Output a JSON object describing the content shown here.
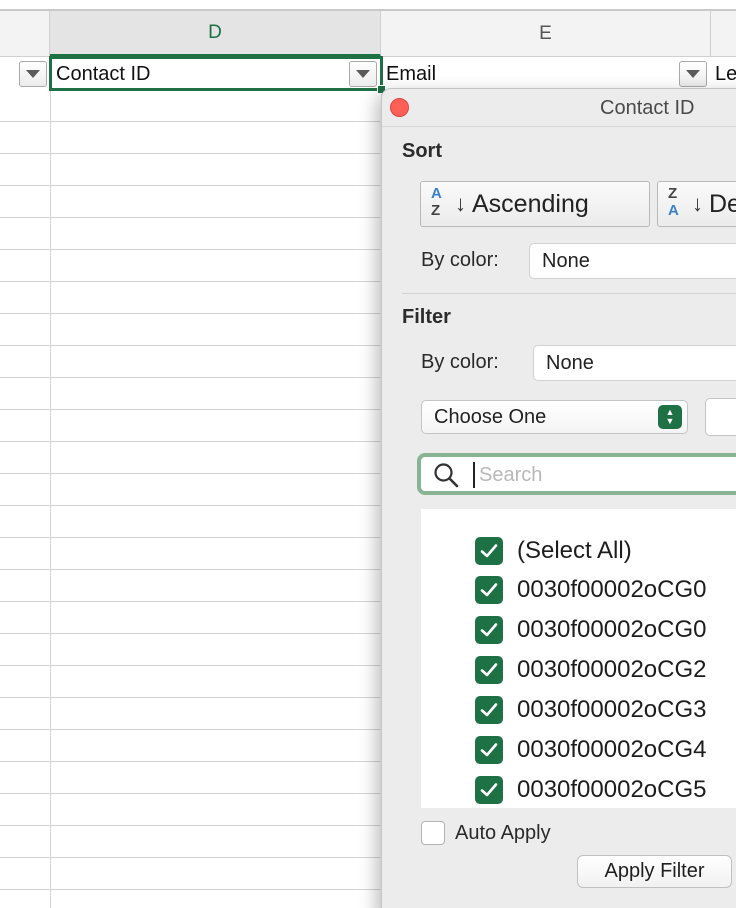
{
  "sheet": {
    "columns": [
      {
        "letter": "D"
      },
      {
        "letter": "E"
      }
    ],
    "headers": {
      "contact_id": "Contact ID",
      "email": "Email",
      "next": "Le"
    }
  },
  "filter_panel": {
    "title": "Contact ID",
    "sort": {
      "label": "Sort",
      "ascending_label": "Ascending",
      "descending_label": "De",
      "by_color_label": "By color:",
      "by_color_value": "None"
    },
    "filter": {
      "label": "Filter",
      "by_color_label": "By color:",
      "by_color_value": "None",
      "condition_value": "Choose One"
    },
    "search": {
      "placeholder": "Search",
      "value": ""
    },
    "items": [
      {
        "label": "(Select All)",
        "checked": true
      },
      {
        "label": "0030f00002oCG0",
        "checked": true
      },
      {
        "label": "0030f00002oCG0",
        "checked": true
      },
      {
        "label": "0030f00002oCG2",
        "checked": true
      },
      {
        "label": "0030f00002oCG3",
        "checked": true
      },
      {
        "label": "0030f00002oCG4",
        "checked": true
      },
      {
        "label": "0030f00002oCG5",
        "checked": true
      }
    ],
    "auto_apply_label": "Auto Apply",
    "auto_apply_checked": false,
    "apply_label": "Apply Filter"
  },
  "colors": {
    "accent_green": "#1e7145",
    "close_red": "#fe5f57",
    "sort_icon_blue": "#3c82c9"
  }
}
